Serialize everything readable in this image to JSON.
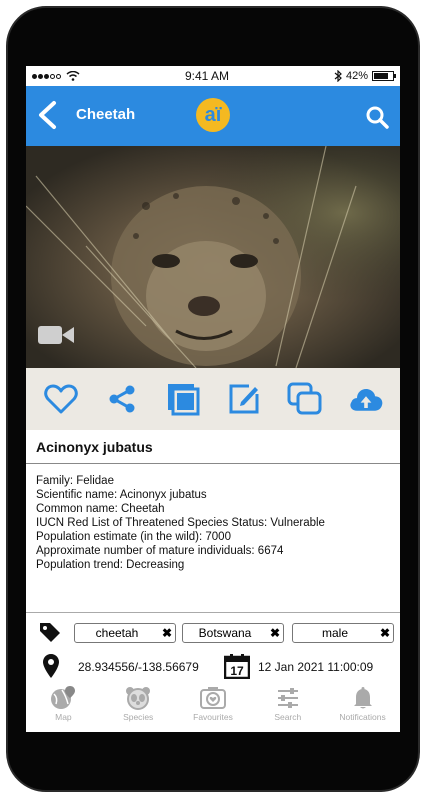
{
  "status_bar": {
    "time": "9:41 AM",
    "battery": "42%"
  },
  "app_bar": {
    "title": "Cheetah",
    "logo_text": "aï",
    "accent_color": "#2c8ae0"
  },
  "photo": {
    "alt": "cheetah photo",
    "media_icon": "video-camera-icon"
  },
  "actions": [
    {
      "name": "favourite",
      "icon": "heart-icon"
    },
    {
      "name": "share",
      "icon": "share-icon"
    },
    {
      "name": "gallery",
      "icon": "gallery-icon"
    },
    {
      "name": "edit",
      "icon": "edit-icon"
    },
    {
      "name": "copy",
      "icon": "copy-icon"
    },
    {
      "name": "upload",
      "icon": "cloud-upload-icon"
    }
  ],
  "species": {
    "heading": "Acinonyx jubatus",
    "lines": [
      "Family: Felidae",
      "Scientific name: Acinonyx jubatus",
      "Common name: Cheetah",
      "IUCN Red List of Threatened Species Status: Vulnerable",
      "Population estimate (in the wild): 7000",
      "Approximate number of mature individuals: 6674",
      "Population trend: Decreasing"
    ]
  },
  "tags": [
    "cheetah",
    "Botswana",
    "male"
  ],
  "location": {
    "coords": "28.934556/-138.56679"
  },
  "datetime": {
    "calendar_day": "17",
    "value": "12 Jan 2021 11:00:09"
  },
  "nav": [
    {
      "label": "Map",
      "icon": "globe-pin-icon"
    },
    {
      "label": "Species",
      "icon": "panda-icon"
    },
    {
      "label": "Favourites",
      "icon": "favourites-camera-icon"
    },
    {
      "label": "Search",
      "icon": "sliders-icon"
    },
    {
      "label": "Notifications",
      "icon": "bell-icon"
    }
  ]
}
